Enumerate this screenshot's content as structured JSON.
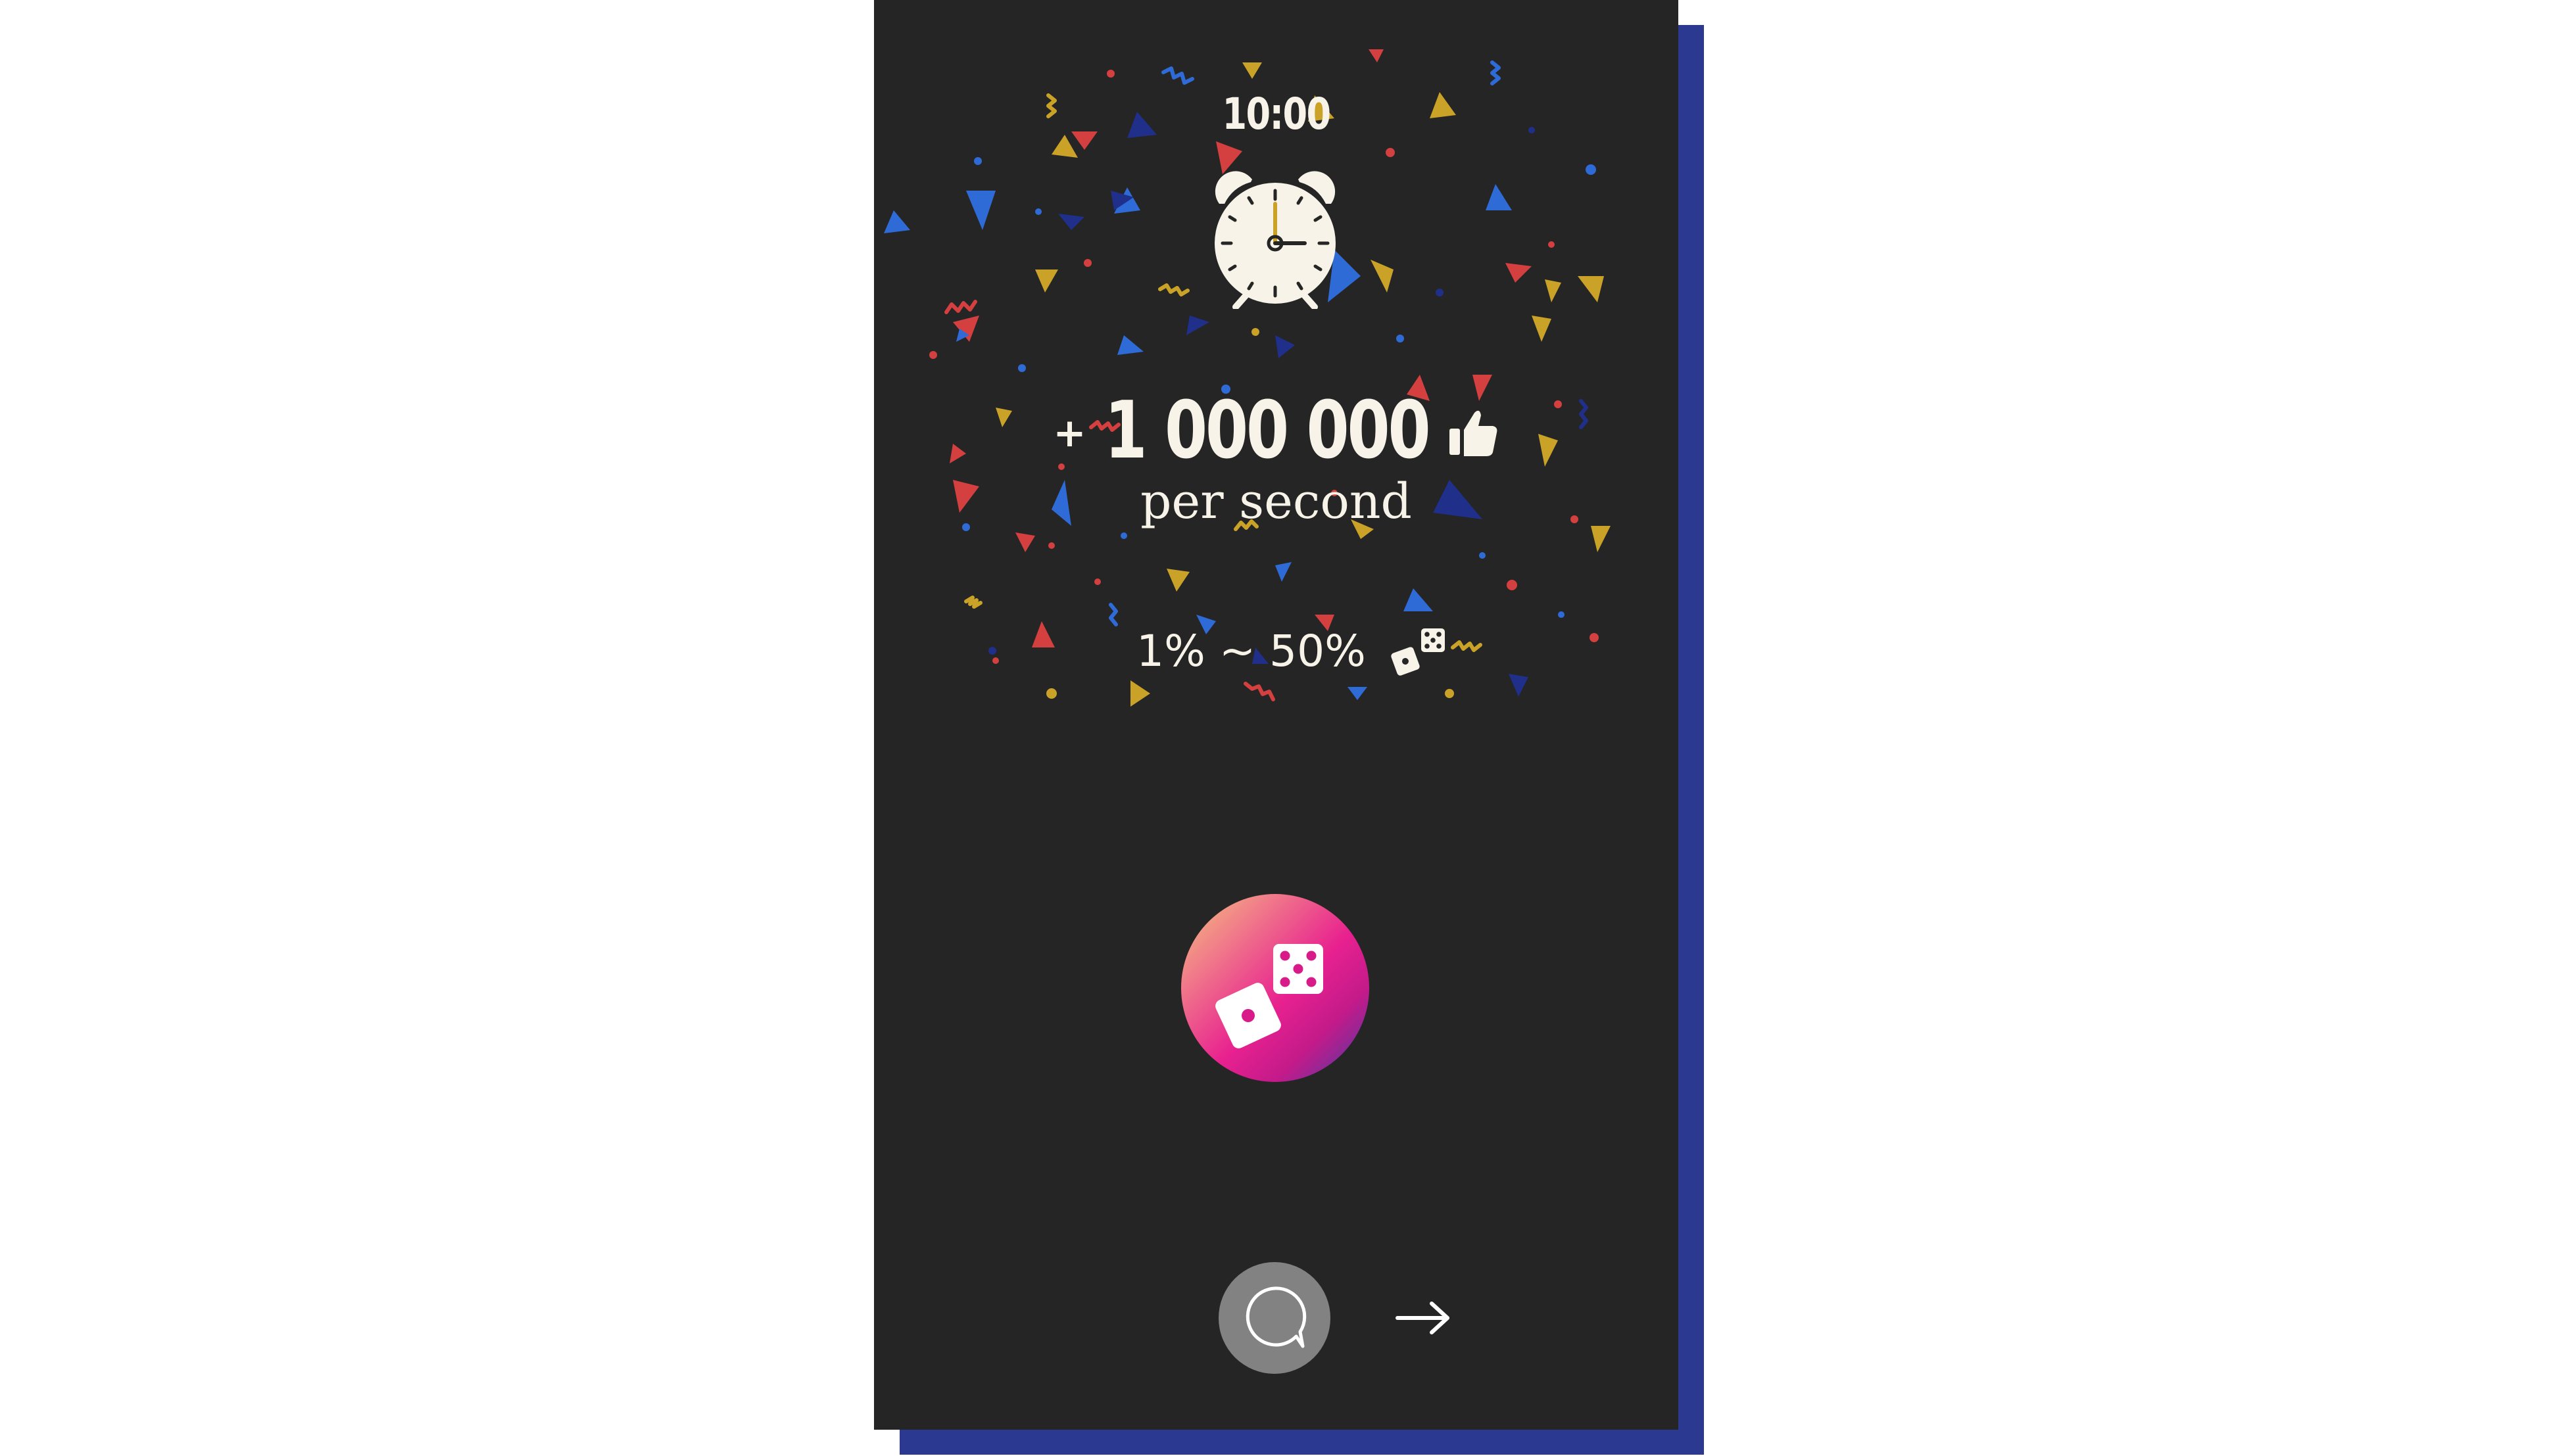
{
  "clock": {
    "time": "10:00"
  },
  "reward": {
    "plus_symbol": "+",
    "amount": "1 000 000",
    "unit": "per second"
  },
  "chance": {
    "range": "1% ~ 50%"
  },
  "icons": {
    "alarm": "alarm-clock-icon",
    "thumb": "thumbs-up-icon",
    "dice": "dice-icon",
    "chat": "chat-bubble-icon",
    "next": "arrow-right-icon"
  },
  "colors": {
    "background": "#252525",
    "shadow": "#2b3991",
    "cream": "#f7f3e8",
    "confetti_red": "#d43f3f",
    "confetti_yellow": "#c9a227",
    "confetti_blue": "#2f6bd6",
    "confetti_navy": "#1f2f8a"
  }
}
